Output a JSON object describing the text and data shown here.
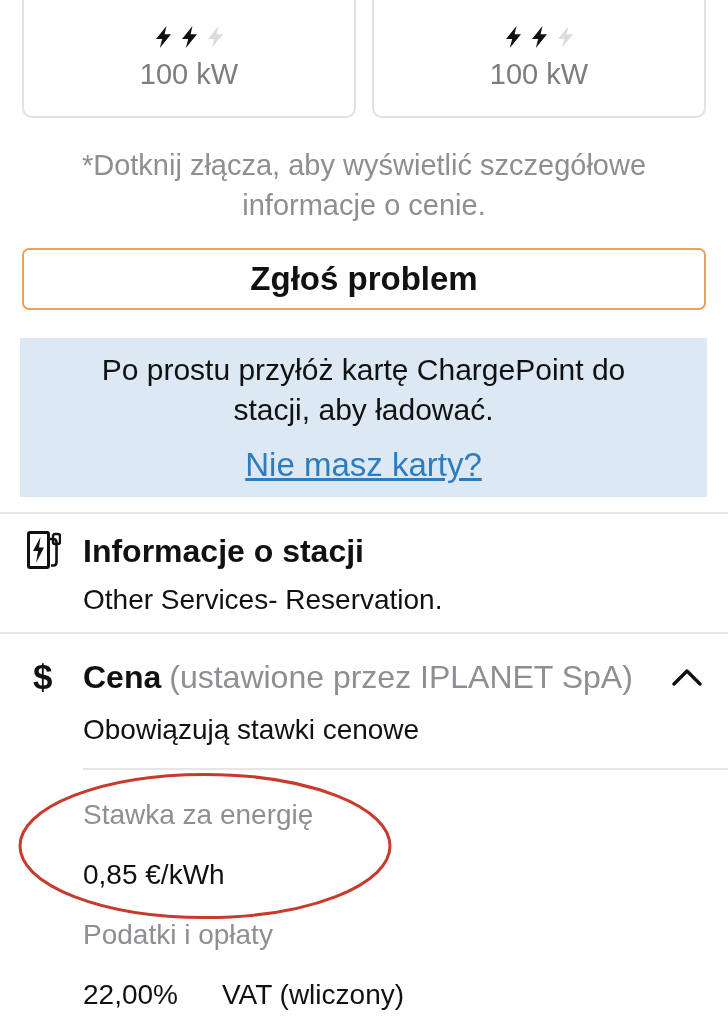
{
  "connectors": [
    {
      "stars": 2,
      "power": "100 kW"
    },
    {
      "stars": 2,
      "power": "100 kW"
    }
  ],
  "hint": "*Dotknij złącza, aby wyświetlić szczegółowe informacje o cenie.",
  "report_button": "Zgłoś problem",
  "card_notice": {
    "text": "Po prostu przyłóż kartę ChargePoint do stacji, aby ładować.",
    "link": "Nie masz karty?"
  },
  "station_info": {
    "title": "Informacje o stacji",
    "text": "Other Services- Reservation."
  },
  "price": {
    "icon": "$",
    "title": "Cena",
    "setter": "(ustawione przez IPLANET SpA)",
    "expanded": true,
    "subtitle": "Obowiązują stawki cenowe",
    "items": [
      {
        "kind": "rate",
        "label": "Stawka za energię",
        "value": "0,85 €/kWh"
      },
      {
        "kind": "tax",
        "label": "Podatki i opłaty",
        "percent": "22,00%",
        "name": "VAT (wliczony)"
      }
    ]
  }
}
